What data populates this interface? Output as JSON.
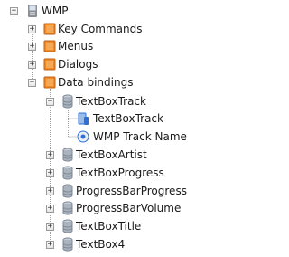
{
  "tree": {
    "root": {
      "label": "WMP",
      "icon": "device-icon",
      "expanded": true
    },
    "categories": [
      {
        "label": "Key Commands",
        "icon": "folder-icon",
        "expanded": false
      },
      {
        "label": "Menus",
        "icon": "folder-icon",
        "expanded": false
      },
      {
        "label": "Dialogs",
        "icon": "folder-icon",
        "expanded": false
      },
      {
        "label": "Data bindings",
        "icon": "folder-icon",
        "expanded": true
      }
    ],
    "bindings": [
      {
        "label": "TextBoxTrack",
        "icon": "database-icon",
        "expanded": true,
        "children": [
          {
            "label": "TextBoxTrack",
            "icon": "binding-source-icon"
          },
          {
            "label": "WMP Track Name",
            "icon": "binding-target-icon"
          }
        ]
      },
      {
        "label": "TextBoxArtist",
        "icon": "database-icon",
        "expanded": false
      },
      {
        "label": "TextBoxProgress",
        "icon": "database-icon",
        "expanded": false
      },
      {
        "label": "ProgressBarProgress",
        "icon": "database-icon",
        "expanded": false
      },
      {
        "label": "ProgressBarVolume",
        "icon": "database-icon",
        "expanded": false
      },
      {
        "label": "TextBoxTitle",
        "icon": "database-icon",
        "expanded": false
      },
      {
        "label": "TextBox4",
        "icon": "database-icon",
        "expanded": false
      }
    ]
  },
  "colors": {
    "folder": "#f08a24",
    "folder_dark": "#c0601a",
    "database": "#a9b4c0",
    "binding_blue": "#2f6fd6",
    "guide": "#a0a0a0"
  }
}
